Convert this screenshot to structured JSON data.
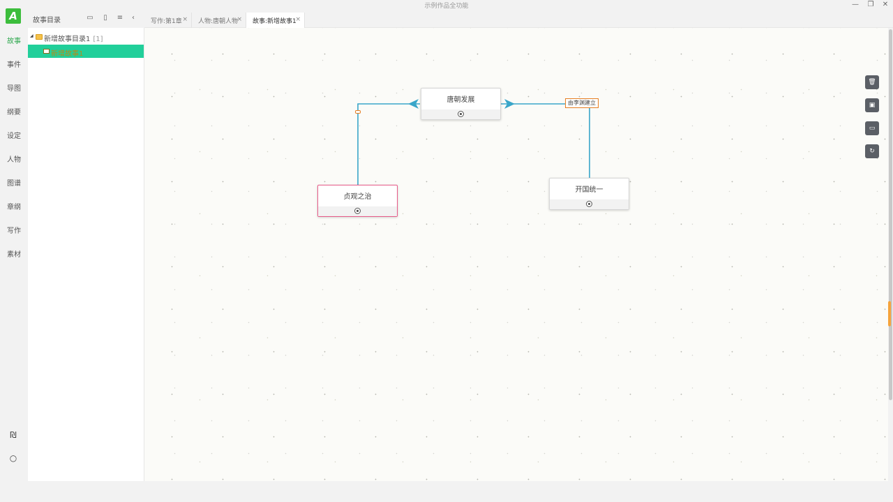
{
  "window": {
    "title": "示例作品全功能",
    "minimize": "—",
    "restore": "❐",
    "close": "✕"
  },
  "rail": {
    "logo": "A",
    "items": [
      {
        "label": "故事",
        "active": true
      },
      {
        "label": "事件"
      },
      {
        "label": "导图"
      },
      {
        "label": "纲要"
      },
      {
        "label": "设定"
      },
      {
        "label": "人物"
      },
      {
        "label": "图谱"
      },
      {
        "label": "章纲"
      },
      {
        "label": "写作"
      },
      {
        "label": "素材"
      }
    ],
    "bottom_icons": {
      "book": "₪",
      "power": "○"
    }
  },
  "directory": {
    "title": "故事目录",
    "tools": {
      "new_folder": "▭",
      "new_file": "▯",
      "menu": "≡",
      "collapse": "‹"
    },
    "folder": {
      "caret": "◢",
      "label": "新增故事目录1",
      "count": "[1]"
    },
    "story": {
      "label": "新增故事1"
    }
  },
  "tabs": [
    {
      "label": "写作:第1章",
      "close": "×"
    },
    {
      "label": "人物:唐朝人物",
      "close": "×"
    },
    {
      "label": "故事:新增故事1",
      "close": "×",
      "active": true
    }
  ],
  "graph": {
    "nodes": {
      "tang": {
        "label": "唐朝发展"
      },
      "zhenguan": {
        "label": "贞观之治"
      },
      "kaiguo": {
        "label": "开国统一"
      }
    },
    "edge_label": "由李渊建立",
    "edge_color": "#3aa6c9"
  },
  "canvas_tools": {
    "delete": "🗑",
    "monitor": "▣",
    "laptop": "▭",
    "refresh": "↻"
  }
}
